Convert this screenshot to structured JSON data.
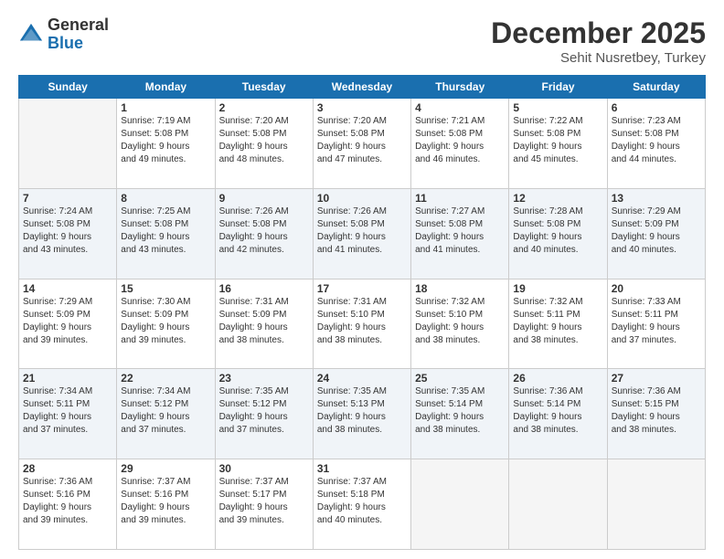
{
  "logo": {
    "general": "General",
    "blue": "Blue"
  },
  "title": "December 2025",
  "subtitle": "Sehit Nusretbey, Turkey",
  "headers": [
    "Sunday",
    "Monday",
    "Tuesday",
    "Wednesday",
    "Thursday",
    "Friday",
    "Saturday"
  ],
  "weeks": [
    [
      {
        "day": "",
        "info": ""
      },
      {
        "day": "1",
        "info": "Sunrise: 7:19 AM\nSunset: 5:08 PM\nDaylight: 9 hours\nand 49 minutes."
      },
      {
        "day": "2",
        "info": "Sunrise: 7:20 AM\nSunset: 5:08 PM\nDaylight: 9 hours\nand 48 minutes."
      },
      {
        "day": "3",
        "info": "Sunrise: 7:20 AM\nSunset: 5:08 PM\nDaylight: 9 hours\nand 47 minutes."
      },
      {
        "day": "4",
        "info": "Sunrise: 7:21 AM\nSunset: 5:08 PM\nDaylight: 9 hours\nand 46 minutes."
      },
      {
        "day": "5",
        "info": "Sunrise: 7:22 AM\nSunset: 5:08 PM\nDaylight: 9 hours\nand 45 minutes."
      },
      {
        "day": "6",
        "info": "Sunrise: 7:23 AM\nSunset: 5:08 PM\nDaylight: 9 hours\nand 44 minutes."
      }
    ],
    [
      {
        "day": "7",
        "info": "Sunrise: 7:24 AM\nSunset: 5:08 PM\nDaylight: 9 hours\nand 43 minutes."
      },
      {
        "day": "8",
        "info": "Sunrise: 7:25 AM\nSunset: 5:08 PM\nDaylight: 9 hours\nand 43 minutes."
      },
      {
        "day": "9",
        "info": "Sunrise: 7:26 AM\nSunset: 5:08 PM\nDaylight: 9 hours\nand 42 minutes."
      },
      {
        "day": "10",
        "info": "Sunrise: 7:26 AM\nSunset: 5:08 PM\nDaylight: 9 hours\nand 41 minutes."
      },
      {
        "day": "11",
        "info": "Sunrise: 7:27 AM\nSunset: 5:08 PM\nDaylight: 9 hours\nand 41 minutes."
      },
      {
        "day": "12",
        "info": "Sunrise: 7:28 AM\nSunset: 5:08 PM\nDaylight: 9 hours\nand 40 minutes."
      },
      {
        "day": "13",
        "info": "Sunrise: 7:29 AM\nSunset: 5:09 PM\nDaylight: 9 hours\nand 40 minutes."
      }
    ],
    [
      {
        "day": "14",
        "info": "Sunrise: 7:29 AM\nSunset: 5:09 PM\nDaylight: 9 hours\nand 39 minutes."
      },
      {
        "day": "15",
        "info": "Sunrise: 7:30 AM\nSunset: 5:09 PM\nDaylight: 9 hours\nand 39 minutes."
      },
      {
        "day": "16",
        "info": "Sunrise: 7:31 AM\nSunset: 5:09 PM\nDaylight: 9 hours\nand 38 minutes."
      },
      {
        "day": "17",
        "info": "Sunrise: 7:31 AM\nSunset: 5:10 PM\nDaylight: 9 hours\nand 38 minutes."
      },
      {
        "day": "18",
        "info": "Sunrise: 7:32 AM\nSunset: 5:10 PM\nDaylight: 9 hours\nand 38 minutes."
      },
      {
        "day": "19",
        "info": "Sunrise: 7:32 AM\nSunset: 5:11 PM\nDaylight: 9 hours\nand 38 minutes."
      },
      {
        "day": "20",
        "info": "Sunrise: 7:33 AM\nSunset: 5:11 PM\nDaylight: 9 hours\nand 37 minutes."
      }
    ],
    [
      {
        "day": "21",
        "info": "Sunrise: 7:34 AM\nSunset: 5:11 PM\nDaylight: 9 hours\nand 37 minutes."
      },
      {
        "day": "22",
        "info": "Sunrise: 7:34 AM\nSunset: 5:12 PM\nDaylight: 9 hours\nand 37 minutes."
      },
      {
        "day": "23",
        "info": "Sunrise: 7:35 AM\nSunset: 5:12 PM\nDaylight: 9 hours\nand 37 minutes."
      },
      {
        "day": "24",
        "info": "Sunrise: 7:35 AM\nSunset: 5:13 PM\nDaylight: 9 hours\nand 38 minutes."
      },
      {
        "day": "25",
        "info": "Sunrise: 7:35 AM\nSunset: 5:14 PM\nDaylight: 9 hours\nand 38 minutes."
      },
      {
        "day": "26",
        "info": "Sunrise: 7:36 AM\nSunset: 5:14 PM\nDaylight: 9 hours\nand 38 minutes."
      },
      {
        "day": "27",
        "info": "Sunrise: 7:36 AM\nSunset: 5:15 PM\nDaylight: 9 hours\nand 38 minutes."
      }
    ],
    [
      {
        "day": "28",
        "info": "Sunrise: 7:36 AM\nSunset: 5:16 PM\nDaylight: 9 hours\nand 39 minutes."
      },
      {
        "day": "29",
        "info": "Sunrise: 7:37 AM\nSunset: 5:16 PM\nDaylight: 9 hours\nand 39 minutes."
      },
      {
        "day": "30",
        "info": "Sunrise: 7:37 AM\nSunset: 5:17 PM\nDaylight: 9 hours\nand 39 minutes."
      },
      {
        "day": "31",
        "info": "Sunrise: 7:37 AM\nSunset: 5:18 PM\nDaylight: 9 hours\nand 40 minutes."
      },
      {
        "day": "",
        "info": ""
      },
      {
        "day": "",
        "info": ""
      },
      {
        "day": "",
        "info": ""
      }
    ]
  ]
}
